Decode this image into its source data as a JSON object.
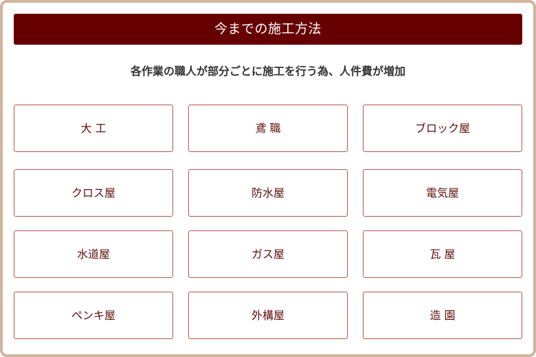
{
  "header": {
    "title": "今までの施工方法"
  },
  "subtitle": "各作業の職人が部分ごとに施工を行う為、人件費が増加",
  "colors": {
    "accent": "#660000",
    "frame": "#d2b49b",
    "box_border": "#b0574a",
    "box_text": "#5e0d0d"
  },
  "trades": [
    [
      "大 工",
      "鳶 職",
      "ブロック屋"
    ],
    [
      "クロス屋",
      "防水屋",
      "電気屋"
    ],
    [
      "水道屋",
      "ガス屋",
      "瓦 屋"
    ],
    [
      "ペンキ屋",
      "外構屋",
      "造 園"
    ]
  ]
}
